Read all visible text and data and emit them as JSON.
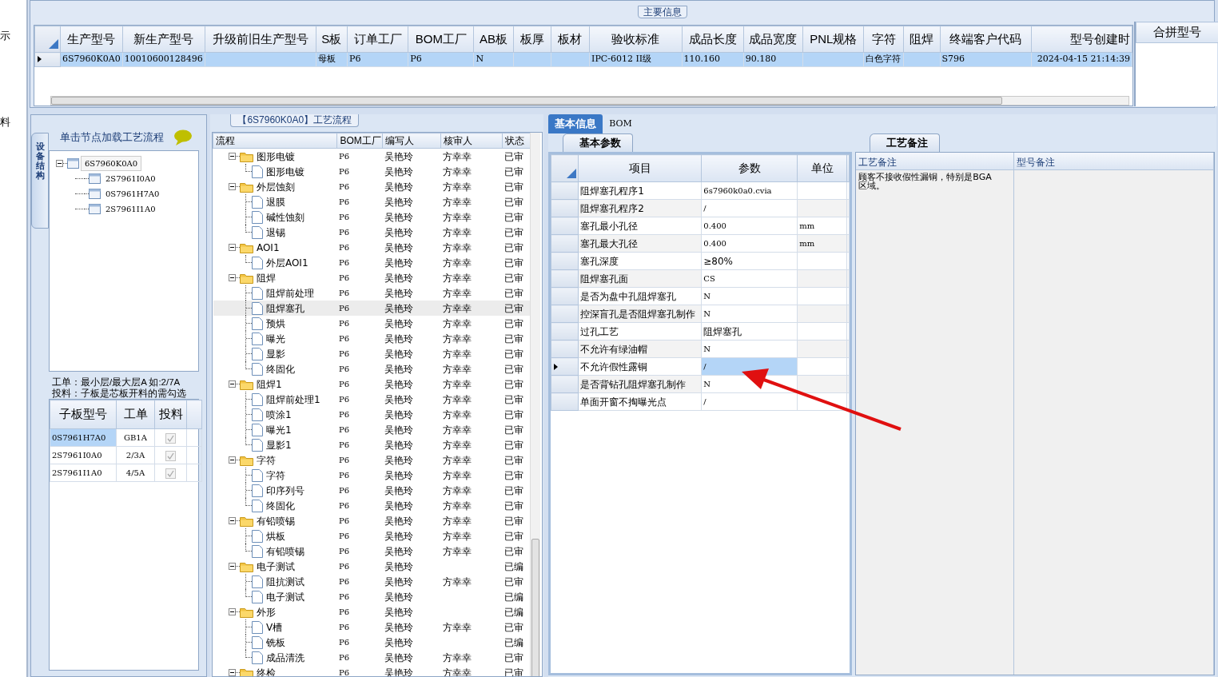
{
  "edge_texts": [
    "示",
    "料"
  ],
  "main_info": {
    "tab": "主要信息",
    "grid": {
      "columns": [
        "生产型号",
        "新生产型号",
        "升级前旧生产型号",
        "S板",
        "订单工厂",
        "BOM工厂",
        "AB板",
        "板厚",
        "板材",
        "验收标准",
        "成品长度",
        "成品宽度",
        "PNL规格",
        "字符",
        "阻焊",
        "终端客户代码",
        "型号创建时"
      ],
      "rows": [
        {
          "selected": true,
          "cells": [
            "6S7960K0A0",
            "10010600128496",
            null,
            "母板",
            "P6",
            "P6",
            "N",
            null,
            null,
            "IPC-6012 II级",
            "110.160",
            "90.180",
            null,
            "白色字符",
            null,
            "S796",
            "2024-04-15 21:14:39"
          ]
        }
      ]
    },
    "side_grid": {
      "columns": [
        "合拼型号"
      ]
    }
  },
  "structure_panel": {
    "vertical_tab": "设备结构",
    "header": "单击节点加载工艺流程",
    "tree": [
      {
        "label": "6S7960K0A0",
        "selected": true,
        "expanded": true,
        "children": [
          {
            "label": "2S7961I0A0",
            "selected": false
          },
          {
            "label": "0S7961H7A0",
            "selected": false
          },
          {
            "label": "2S7961I1A0",
            "selected": false
          }
        ]
      }
    ],
    "notes": [
      "工单：最小层/最大层A 如:2/7A",
      "投料：子板是芯板开料的需勾选"
    ],
    "sub_grid": {
      "columns": [
        "子板型号",
        "工单",
        "投料"
      ],
      "rows": [
        {
          "model": "0S7961H7A0",
          "order": "GB1A",
          "checked": true,
          "selected": true
        },
        {
          "model": "2S7961I0A0",
          "order": "2/3A",
          "checked": true,
          "selected": false
        },
        {
          "model": "2S7961I1A0",
          "order": "4/5A",
          "checked": true,
          "selected": false
        }
      ]
    }
  },
  "process_flow": {
    "title": "【6S7960K0A0】工艺流程",
    "columns": [
      "流程",
      "BOM工厂",
      "编写人",
      "核审人",
      "状态"
    ],
    "groups": [
      {
        "name": "图形电镀",
        "factory": "P6",
        "writer": "吴艳玲",
        "reviewer": "方幸幸",
        "status": "已审",
        "expanded": true,
        "selected": false,
        "children": [
          {
            "name": "图形电镀",
            "factory": "P6",
            "writer": "吴艳玲",
            "reviewer": "方幸幸",
            "status": "已审",
            "selected": false
          }
        ]
      },
      {
        "name": "外层蚀刻",
        "factory": "P6",
        "writer": "吴艳玲",
        "reviewer": "方幸幸",
        "status": "已审",
        "expanded": true,
        "selected": false,
        "children": [
          {
            "name": "退膜",
            "factory": "P6",
            "writer": "吴艳玲",
            "reviewer": "方幸幸",
            "status": "已审",
            "selected": false
          },
          {
            "name": "碱性蚀刻",
            "factory": "P6",
            "writer": "吴艳玲",
            "reviewer": "方幸幸",
            "status": "已审",
            "selected": false
          },
          {
            "name": "退锡",
            "factory": "P6",
            "writer": "吴艳玲",
            "reviewer": "方幸幸",
            "status": "已审",
            "selected": false
          }
        ]
      },
      {
        "name": "AOI1",
        "factory": "P6",
        "writer": "吴艳玲",
        "reviewer": "方幸幸",
        "status": "已审",
        "expanded": true,
        "selected": false,
        "children": [
          {
            "name": "外层AOI1",
            "factory": "P6",
            "writer": "吴艳玲",
            "reviewer": "方幸幸",
            "status": "已审",
            "selected": false
          }
        ]
      },
      {
        "name": "阻焊",
        "factory": "P6",
        "writer": "吴艳玲",
        "reviewer": "方幸幸",
        "status": "已审",
        "expanded": true,
        "selected": false,
        "children": [
          {
            "name": "阻焊前处理",
            "factory": "P6",
            "writer": "吴艳玲",
            "reviewer": "方幸幸",
            "status": "已审",
            "selected": false
          },
          {
            "name": "阻焊塞孔",
            "factory": "P6",
            "writer": "吴艳玲",
            "reviewer": "方幸幸",
            "status": "已审",
            "selected": true
          },
          {
            "name": "预烘",
            "factory": "P6",
            "writer": "吴艳玲",
            "reviewer": "方幸幸",
            "status": "已审",
            "selected": false
          },
          {
            "name": "曝光",
            "factory": "P6",
            "writer": "吴艳玲",
            "reviewer": "方幸幸",
            "status": "已审",
            "selected": false
          },
          {
            "name": "显影",
            "factory": "P6",
            "writer": "吴艳玲",
            "reviewer": "方幸幸",
            "status": "已审",
            "selected": false
          },
          {
            "name": "终固化",
            "factory": "P6",
            "writer": "吴艳玲",
            "reviewer": "方幸幸",
            "status": "已审",
            "selected": false
          }
        ]
      },
      {
        "name": "阻焊1",
        "factory": "P6",
        "writer": "吴艳玲",
        "reviewer": "方幸幸",
        "status": "已审",
        "expanded": true,
        "selected": false,
        "children": [
          {
            "name": "阻焊前处理1",
            "factory": "P6",
            "writer": "吴艳玲",
            "reviewer": "方幸幸",
            "status": "已审",
            "selected": false
          },
          {
            "name": "喷涂1",
            "factory": "P6",
            "writer": "吴艳玲",
            "reviewer": "方幸幸",
            "status": "已审",
            "selected": false
          },
          {
            "name": "曝光1",
            "factory": "P6",
            "writer": "吴艳玲",
            "reviewer": "方幸幸",
            "status": "已审",
            "selected": false
          },
          {
            "name": "显影1",
            "factory": "P6",
            "writer": "吴艳玲",
            "reviewer": "方幸幸",
            "status": "已审",
            "selected": false
          }
        ]
      },
      {
        "name": "字符",
        "factory": "P6",
        "writer": "吴艳玲",
        "reviewer": "方幸幸",
        "status": "已审",
        "expanded": true,
        "selected": false,
        "children": [
          {
            "name": "字符",
            "factory": "P6",
            "writer": "吴艳玲",
            "reviewer": "方幸幸",
            "status": "已审",
            "selected": false
          },
          {
            "name": "印序列号",
            "factory": "P6",
            "writer": "吴艳玲",
            "reviewer": "方幸幸",
            "status": "已审",
            "selected": false
          },
          {
            "name": "终固化",
            "factory": "P6",
            "writer": "吴艳玲",
            "reviewer": "方幸幸",
            "status": "已审",
            "selected": false
          }
        ]
      },
      {
        "name": "有铅喷锡",
        "factory": "P6",
        "writer": "吴艳玲",
        "reviewer": "方幸幸",
        "status": "已审",
        "expanded": true,
        "selected": false,
        "children": [
          {
            "name": "烘板",
            "factory": "P6",
            "writer": "吴艳玲",
            "reviewer": "方幸幸",
            "status": "已审",
            "selected": false
          },
          {
            "name": "有铅喷锡",
            "factory": "P6",
            "writer": "吴艳玲",
            "reviewer": "方幸幸",
            "status": "已审",
            "selected": false
          }
        ]
      },
      {
        "name": "电子测试",
        "factory": "P6",
        "writer": "吴艳玲",
        "status": "已编",
        "expanded": true,
        "selected": false,
        "children": [
          {
            "name": "阻抗测试",
            "factory": "P6",
            "writer": "吴艳玲",
            "reviewer": "方幸幸",
            "status": "已审",
            "selected": false
          },
          {
            "name": "电子测试",
            "factory": "P6",
            "writer": "吴艳玲",
            "status": "已编",
            "selected": false
          }
        ]
      },
      {
        "name": "外形",
        "factory": "P6",
        "writer": "吴艳玲",
        "status": "已编",
        "expanded": true,
        "selected": false,
        "children": [
          {
            "name": "V槽",
            "factory": "P6",
            "writer": "吴艳玲",
            "reviewer": "方幸幸",
            "status": "已审",
            "selected": false
          },
          {
            "name": "铣板",
            "factory": "P6",
            "writer": "吴艳玲",
            "status": "已编",
            "selected": false
          },
          {
            "name": "成品清洗",
            "factory": "P6",
            "writer": "吴艳玲",
            "reviewer": "方幸幸",
            "status": "已审",
            "selected": false
          }
        ]
      },
      {
        "name": "终检",
        "factory": "P6",
        "writer": "吴艳玲",
        "reviewer": "方幸幸",
        "status": "已审",
        "expanded": true,
        "selected": false
      }
    ]
  },
  "detail": {
    "tabs": [
      {
        "label": "基本信息",
        "selected": true
      },
      {
        "label": "BOM",
        "selected": false
      }
    ],
    "param_tab": "基本参数",
    "param_grid": {
      "columns": [
        "项目",
        "参数",
        "单位"
      ],
      "rows": [
        {
          "item": "阻焊塞孔程序1",
          "value": "6s7960k0a0.cvia",
          "selected": false
        },
        {
          "item": "阻焊塞孔程序2",
          "value": "/",
          "selected": false
        },
        {
          "item": "塞孔最小孔径",
          "value": "0.400",
          "unit": "mm",
          "selected": false
        },
        {
          "item": "塞孔最大孔径",
          "value": "0.400",
          "unit": "mm",
          "selected": false
        },
        {
          "item": "塞孔深度",
          "value": "≥80%",
          "selected": false
        },
        {
          "item": "阻焊塞孔面",
          "value": "CS",
          "selected": false
        },
        {
          "item": "是否为盘中孔阻焊塞孔",
          "value": "N",
          "selected": false
        },
        {
          "item": "控深盲孔是否阻焊塞孔制作",
          "value": "N",
          "selected": false
        },
        {
          "item": "过孔工艺",
          "value": "阻焊塞孔",
          "selected": false
        },
        {
          "item": "不允许有绿油帽",
          "value": "N",
          "selected": false
        },
        {
          "item": "不允许假性露铜",
          "value": "/",
          "selected": true
        },
        {
          "item": "是否背钻孔阻焊塞孔制作",
          "value": "N",
          "selected": false
        },
        {
          "item": "单面开窗不掏曝光点",
          "value": "/",
          "selected": false
        }
      ]
    },
    "remark_tab": "工艺备注",
    "remark_grid": {
      "columns": [
        "工艺备注",
        "型号备注"
      ],
      "process_remark": "顾客不接收假性漏铜，特别是BGA区域。"
    }
  }
}
